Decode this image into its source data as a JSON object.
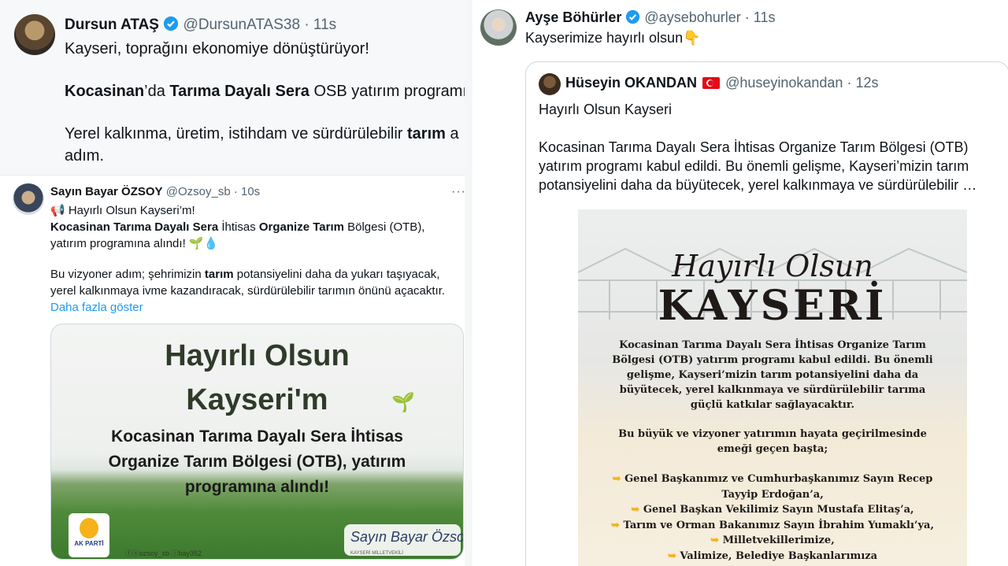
{
  "left_top": {
    "name": "Dursun ATAŞ",
    "handle": "@DursunATAS38",
    "sep": "·",
    "time": "11s",
    "line1": "Kayseri, toprağını ekonomiye dönüştürüyor!",
    "line2_bold1": "Kocasinan",
    "line2_mid1": "’da ",
    "line2_bold2": "Tarıma Dayalı Sera",
    "line2_rest": " OSB yatırım programı",
    "line3_pre": "Yerel kalkınma, üretim, istihdam ve sürdürülebilir ",
    "line3_bold": "tarım",
    "line3_post": " a",
    "line4": "adım."
  },
  "left_bottom": {
    "name": "Sayın Bayar ÖZSOY",
    "handle": "@Ozsoy_sb",
    "sep": "·",
    "time": "10s",
    "more": "···",
    "line1": "📢 Hayırlı Olsun Kayseri’m!",
    "line2_bold1": "Kocasinan Tarıma Dayalı Sera",
    "line2_mid": " İhtisas ",
    "line2_bold2": "Organize Tarım",
    "line2_post": " Bölgesi (OTB),",
    "line3": "yatırım programına alındı! 🌱💧",
    "line4_pre": "Bu vizyoner adım; şehrimizin ",
    "line4_bold": "tarım",
    "line4_post": " potansiyelini daha da yukarı taşıyacak,",
    "line5": "yerel kalkınmaya ivme kazandıracak, sürdürülebilir tarımın önünü açacaktır.",
    "show_more": "Daha fazla göster",
    "card": {
      "title1": "Hayırlı Olsun",
      "title2": "Kayseri'm",
      "sub1": "Kocasinan Tarıma Dayalı Sera İhtisas",
      "sub2": "Organize Tarım Bölgesi (OTB), yatırım",
      "sub3": "programına alındı!",
      "logo_text": "AK PARTİ",
      "handles": "ⓕⓧozsoy_sb  ⓘbay352",
      "sign": "Sayın Bayar Özsoy",
      "sign_sub": "KAYSERİ MİLLETVEKİLİ"
    }
  },
  "right": {
    "name": "Ayşe Böhürler",
    "handle": "@aysebohurler",
    "sep": "·",
    "time": "11s",
    "body": "Kayserimize hayırlı olsun👇",
    "quote": {
      "name": "Hüseyin OKANDAN",
      "handle": "@huseyinokandan",
      "sep": "·",
      "time": "12s",
      "line1": "Hayırlı Olsun Kayseri",
      "line2": "Kocasinan Tarıma Dayalı Sera İhtisas Organize Tarım Bölgesi (OTB)",
      "line3": "yatırım programı kabul edildi. Bu önemli gelişme, Kayseri’mizin tarım",
      "line4": "potansiyelini daha da büyütecek, yerel kalkınmaya ve sürdürülebilir …",
      "image": {
        "script": "Hayırlı Olsun",
        "title": "KAYSERİ",
        "t1": "Kocasinan Tarıma Dayalı Sera İhtisas Organize Tarım",
        "t2": "Bölgesi (OTB) yatırım programı kabul edildi. Bu önemli",
        "t3": "gelişme, Kayseri’mizin tarım potansiyelini daha da",
        "t4": "büyütecek, yerel kalkınmaya ve sürdürülebilir tarıma",
        "t5": "güçlü katkılar sağlayacaktır.",
        "t6": "Bu büyük ve vizyoner yatırımın hayata geçirilmesinde",
        "t7": "emeği geçen başta;",
        "l1": "Genel Başkanımız ve Cumhurbaşkanımız Sayın Recep",
        "l1b": "Tayyip Erdoğan’a,",
        "l2": "Genel Başkan Vekilimiz Sayın Mustafa Elitaş’a,",
        "l3": "Tarım ve Orman Bakanımız Sayın İbrahim Yumaklı’ya,",
        "l4": "Milletvekillerimize,",
        "l5": "Valimize, Belediye Başkanlarımıza"
      }
    }
  },
  "colors": {
    "verified": "#1d9bf0",
    "link": "#1d9bf0",
    "muted": "#536471"
  },
  "icons": [
    "verified-badge-icon",
    "more-icon",
    "turkish-flag-icon",
    "pointing-hand-icon"
  ]
}
